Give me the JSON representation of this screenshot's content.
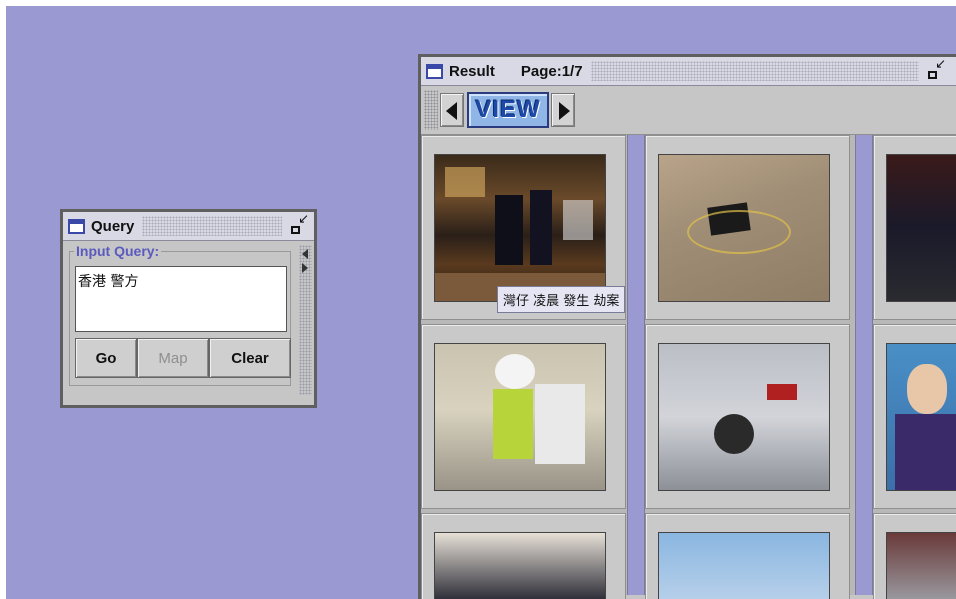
{
  "query_window": {
    "title": "Query",
    "legend": "Input Query:",
    "input_value": "香港 警方",
    "buttons": {
      "go": "Go",
      "map": "Map",
      "clear": "Clear"
    }
  },
  "result_window": {
    "title": "Result",
    "page": "Page:1/7",
    "view_button": "VIEW",
    "tooltip": "灣仔 凌晨 發生 劫案",
    "thumbnails": [
      {
        "id": "r1c1",
        "description": "night street crime scene"
      },
      {
        "id": "r1c2",
        "description": "object on ground"
      },
      {
        "id": "r1c3",
        "description": "police officers at night"
      },
      {
        "id": "r2c1",
        "description": "officer with helmet"
      },
      {
        "id": "r2c2",
        "description": "damaged car"
      },
      {
        "id": "r2c3",
        "description": "news anchor"
      },
      {
        "id": "r3c1",
        "description": "person in white"
      },
      {
        "id": "r3c2",
        "description": "sky scene"
      },
      {
        "id": "r3c3",
        "description": "street"
      }
    ]
  },
  "colors": {
    "desktop": "#9a99d2",
    "frame": "#c6c6c6",
    "accent": "#5a5abf"
  }
}
